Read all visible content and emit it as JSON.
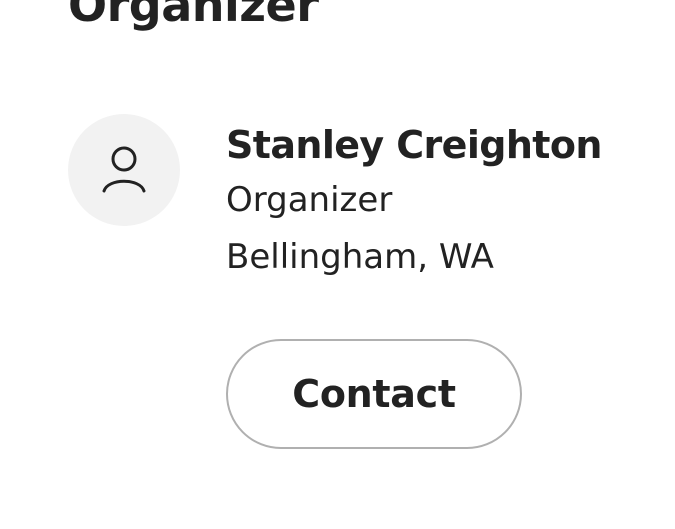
{
  "section": {
    "title": "Organizer"
  },
  "organizer": {
    "avatar_icon": "user-outline-icon",
    "name": "Stanley Creighton",
    "role": "Organizer",
    "location": "Bellingham, WA"
  },
  "actions": {
    "contact_label": "Contact"
  },
  "colors": {
    "text": "#222222",
    "avatar_background": "#f2f2f2",
    "button_border": "#b0b0b0",
    "background": "#ffffff"
  }
}
